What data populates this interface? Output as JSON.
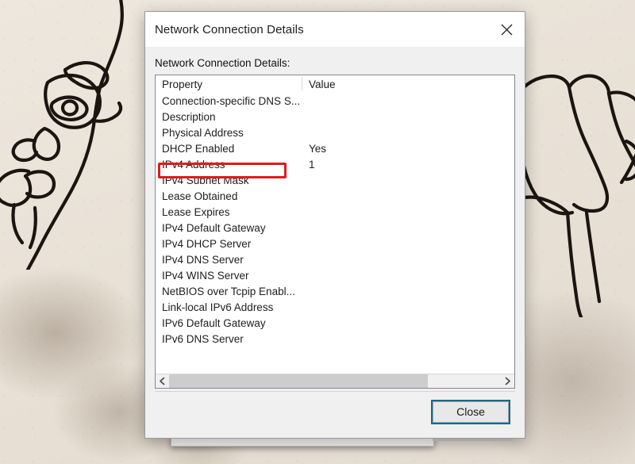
{
  "desktop": {
    "artwork_left": "line-art-face-drawing",
    "artwork_right": "line-art-flower-drawing",
    "background_color": "#e9e1d6"
  },
  "dialog": {
    "title": "Network Connection Details",
    "close_icon": "close-icon",
    "section_label": "Network Connection Details:",
    "close_button_label": "Close"
  },
  "list": {
    "columns": [
      "Property",
      "Value"
    ],
    "rows": [
      {
        "property": "Connection-specific DNS S...",
        "value": ""
      },
      {
        "property": "Description",
        "value": ""
      },
      {
        "property": "Physical Address",
        "value": ""
      },
      {
        "property": "DHCP Enabled",
        "value": "Yes"
      },
      {
        "property": "IPv4 Address",
        "value": "1",
        "highlighted": true
      },
      {
        "property": "IPv4 Subnet Mask",
        "value": ""
      },
      {
        "property": "Lease Obtained",
        "value": ""
      },
      {
        "property": "Lease Expires",
        "value": ""
      },
      {
        "property": "IPv4 Default Gateway",
        "value": ""
      },
      {
        "property": "IPv4 DHCP Server",
        "value": ""
      },
      {
        "property": "IPv4 DNS Server",
        "value": ""
      },
      {
        "property": "IPv4 WINS Server",
        "value": ""
      },
      {
        "property": "NetBIOS over Tcpip Enabl...",
        "value": ""
      },
      {
        "property": "Link-local IPv6 Address",
        "value": ""
      },
      {
        "property": "IPv6 Default Gateway",
        "value": ""
      },
      {
        "property": "IPv6 DNS Server",
        "value": ""
      }
    ],
    "highlight_color": "#e01b1b",
    "highlight_target": "IPv4 Address"
  },
  "scrollbar": {
    "left_arrow_icon": "chevron-left-icon",
    "right_arrow_icon": "chevron-right-icon",
    "thumb_fraction": 0.78
  }
}
